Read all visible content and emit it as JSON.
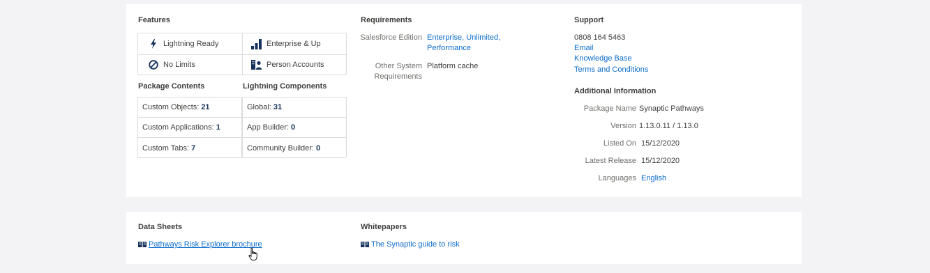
{
  "features": {
    "heading": "Features",
    "items": [
      {
        "label": "Lightning Ready",
        "icon": "lightning-bolt-icon"
      },
      {
        "label": "Enterprise & Up",
        "icon": "bar-chart-icon"
      },
      {
        "label": "No Limits",
        "icon": "no-limits-icon"
      },
      {
        "label": "Person Accounts",
        "icon": "person-accounts-icon"
      }
    ]
  },
  "package_contents": {
    "heading": "Package Contents",
    "rows": [
      {
        "label": "Custom Objects:",
        "value": "21"
      },
      {
        "label": "Custom Applications:",
        "value": "1"
      },
      {
        "label": "Custom Tabs:",
        "value": "7"
      }
    ]
  },
  "lightning_components": {
    "heading": "Lightning Components",
    "rows": [
      {
        "label": "Global:",
        "value": "31"
      },
      {
        "label": "App Builder:",
        "value": "0"
      },
      {
        "label": "Community Builder:",
        "value": "0"
      }
    ]
  },
  "requirements": {
    "heading": "Requirements",
    "edition_label": "Salesforce Edition",
    "edition_value_line1": "Enterprise, Unlimited,",
    "edition_value_line2": "Performance",
    "other_label_line1": "Other System",
    "other_label_line2": "Requirements",
    "other_value": "Platform cache"
  },
  "support": {
    "heading": "Support",
    "phone": "0808 164 5463",
    "email": "Email",
    "knowledge_base": "Knowledge Base",
    "terms": "Terms and Conditions"
  },
  "additional_info": {
    "heading": "Additional Information",
    "rows": [
      {
        "label": "Package Name",
        "value": "Synaptic Pathways",
        "link": false
      },
      {
        "label": "Version",
        "value": "1.13.0.11 / 1.13.0",
        "link": false
      },
      {
        "label": "Listed On",
        "value": "15/12/2020",
        "link": false
      },
      {
        "label": "Latest Release",
        "value": "15/12/2020",
        "link": false
      },
      {
        "label": "Languages",
        "value": "English",
        "link": true
      }
    ]
  },
  "resources": {
    "data_sheets_heading": "Data Sheets",
    "data_sheet_link": "Pathways Risk Explorer brochure",
    "whitepapers_heading": "Whitepapers",
    "whitepaper_link": "The Synaptic guide to risk"
  },
  "colors": {
    "background": "#f3f3f5",
    "card": "#ffffff",
    "link": "#0b6bcb",
    "icon": "#16325c",
    "border": "#dddbda"
  }
}
